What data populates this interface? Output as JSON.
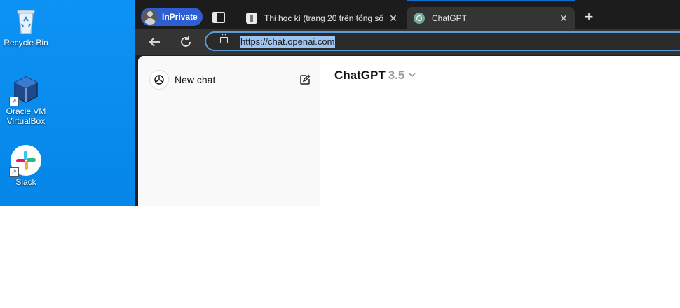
{
  "desktop": {
    "icons": [
      {
        "label": "Recycle Bin"
      },
      {
        "label": "Oracle VM VirtualBox"
      },
      {
        "label": "Slack"
      }
    ]
  },
  "browser": {
    "profile_label": "InPrivate",
    "tabs": [
      {
        "title": "Thi học kì (trang 20 trên tổng số",
        "close": "✕"
      },
      {
        "title": "ChatGPT",
        "close": "✕"
      }
    ],
    "new_tab": "+",
    "address": "https://chat.openai.com"
  },
  "page": {
    "sidebar": {
      "new_chat_label": "New chat"
    },
    "header": {
      "model_name": "ChatGPT",
      "model_version": "3.5"
    }
  }
}
